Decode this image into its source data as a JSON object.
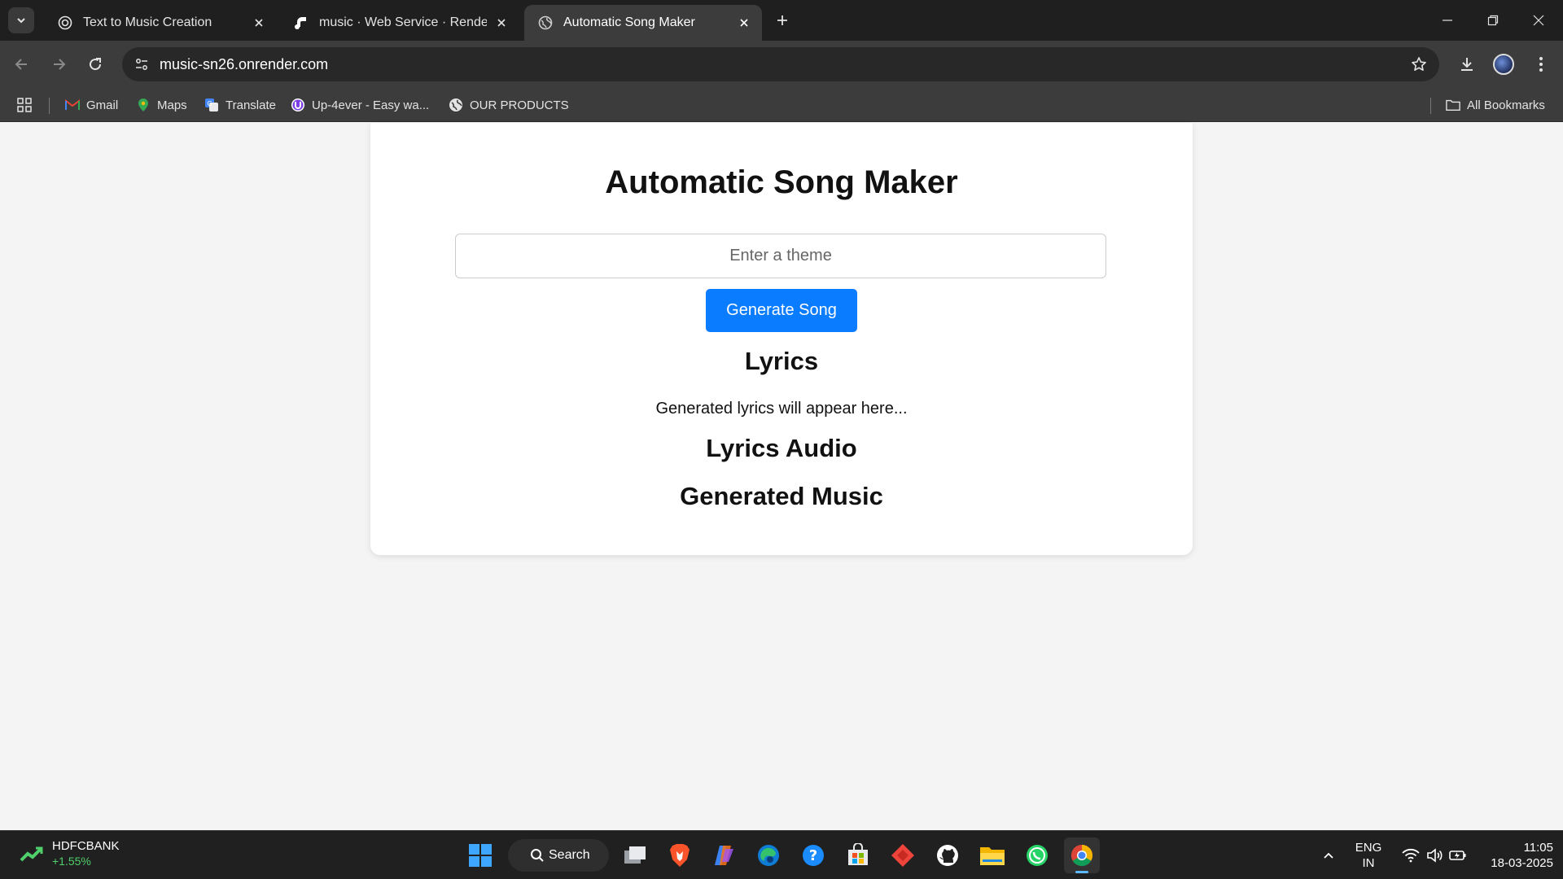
{
  "tabs": [
    {
      "title": "Text to Music Creation",
      "icon": "openai-icon"
    },
    {
      "title": "music · Web Service · Render D",
      "icon": "render-icon"
    },
    {
      "title": "Automatic Song Maker",
      "icon": "globe-icon"
    }
  ],
  "address_bar": {
    "url": "music-sn26.onrender.com"
  },
  "bookmarks": [
    {
      "label": "Gmail",
      "icon": "gmail-icon"
    },
    {
      "label": "Maps",
      "icon": "maps-icon"
    },
    {
      "label": "Translate",
      "icon": "translate-icon"
    },
    {
      "label": "Up-4ever - Easy wa...",
      "icon": "up4ever-icon"
    },
    {
      "label": "OUR PRODUCTS",
      "icon": "globe-icon"
    }
  ],
  "all_bookmarks_label": "All Bookmarks",
  "page": {
    "title": "Automatic Song Maker",
    "theme_placeholder": "Enter a theme",
    "generate_button": "Generate Song",
    "lyrics_heading": "Lyrics",
    "lyrics_placeholder": "Generated lyrics will appear here...",
    "lyrics_audio_heading": "Lyrics Audio",
    "generated_music_heading": "Generated Music",
    "accent_color": "#0a7cff"
  },
  "taskbar": {
    "stock_name": "HDFCBANK",
    "stock_change": "+1.55%",
    "search_label": "Search",
    "language_line1": "ENG",
    "language_line2": "IN",
    "time": "11:05",
    "date": "18-03-2025"
  }
}
